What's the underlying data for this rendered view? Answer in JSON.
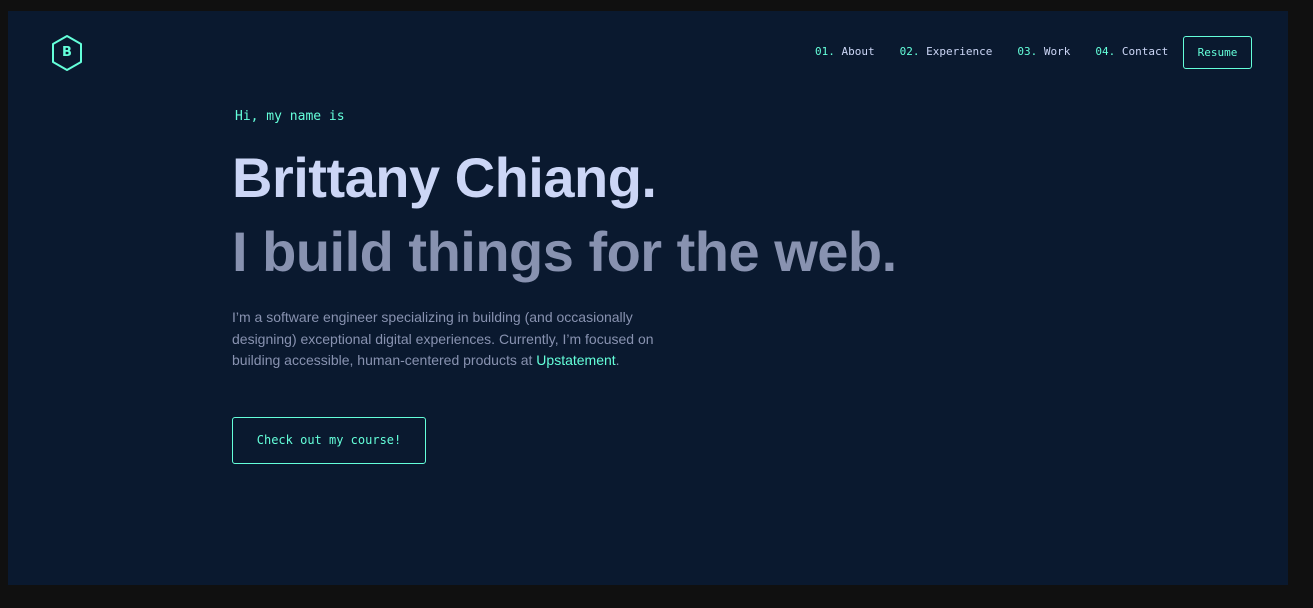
{
  "logo": {
    "letter": "B",
    "icon": "hexagon-logo-icon",
    "color": "#64ffda"
  },
  "nav": {
    "items": [
      {
        "number": "01.",
        "label": "About"
      },
      {
        "number": "02.",
        "label": "Experience"
      },
      {
        "number": "03.",
        "label": "Work"
      },
      {
        "number": "04.",
        "label": "Contact"
      }
    ],
    "resume_label": "Resume"
  },
  "hero": {
    "greeting": "Hi, my name is",
    "name": "Brittany Chiang.",
    "tagline": "I build things for the web.",
    "intro_before_link": "I’m a software engineer specializing in building (and occasionally designing) exceptional digital experiences. Currently, I’m focused on building accessible, human-centered products at ",
    "intro_link": "Upstatement",
    "intro_after_link": ".",
    "cta_label": "Check out my course!"
  },
  "colors": {
    "background": "#0a192f",
    "accent": "#64ffda",
    "heading": "#ccd6f6",
    "body_text": "#8892b0",
    "outer_frame": "#101010"
  }
}
